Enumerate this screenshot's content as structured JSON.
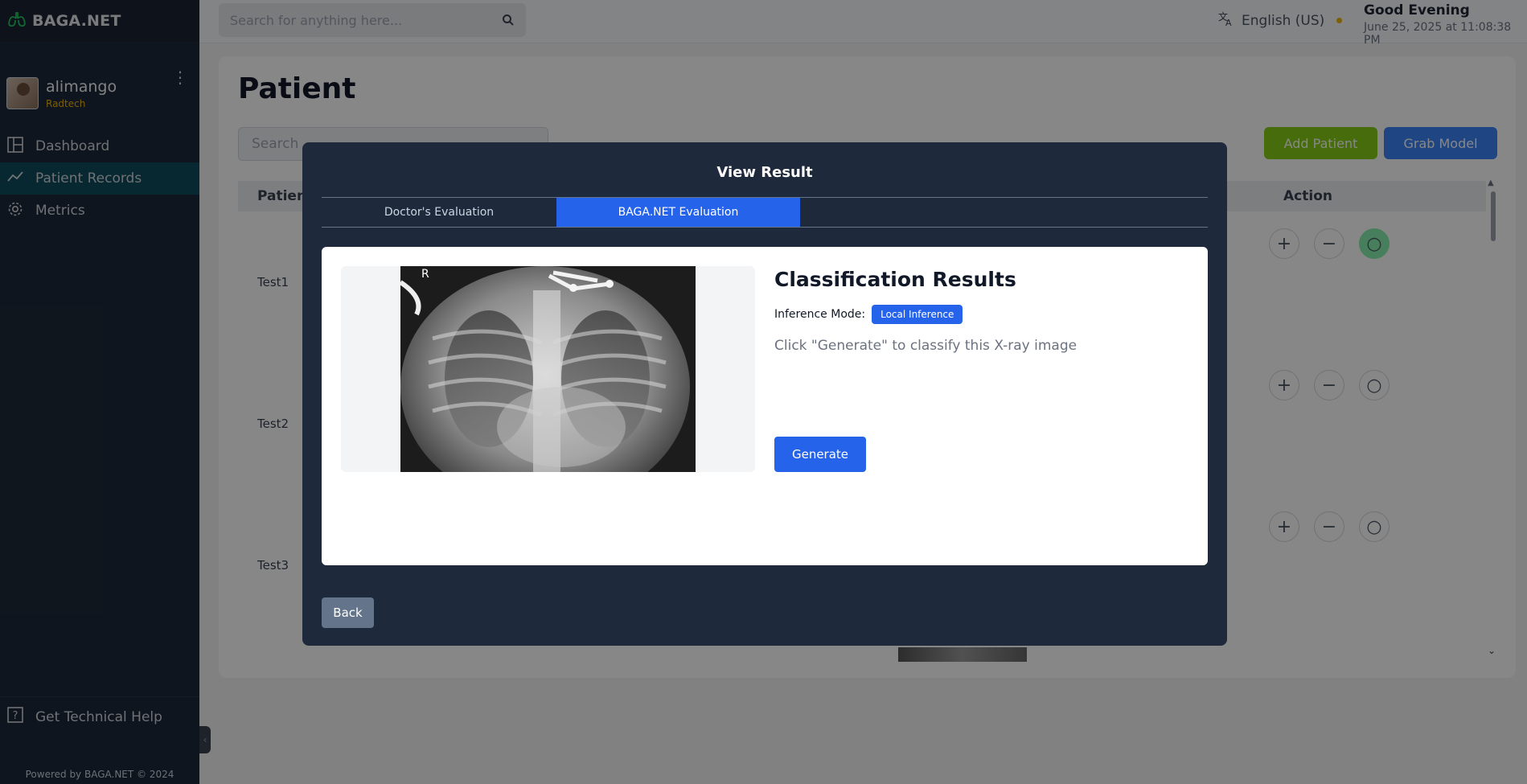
{
  "app": {
    "brand": "BAGA.NET"
  },
  "user": {
    "name": "alimango",
    "role": "Radtech"
  },
  "sidebar": {
    "items": [
      {
        "label": "Dashboard",
        "icon": "layout-icon"
      },
      {
        "label": "Patient Records",
        "icon": "trend-icon"
      },
      {
        "label": "Metrics",
        "icon": "gear-icon"
      }
    ],
    "help": "Get Technical Help",
    "footer": "Powered by BAGA.NET © 2024"
  },
  "topbar": {
    "search_placeholder": "Search for anything here...",
    "language": "English (US)",
    "greeting": "Good Evening",
    "datetime": "June 25, 2025 at 11:08:38 PM"
  },
  "page": {
    "title": "Patient",
    "search_placeholder": "Search",
    "add_label": "Add Patient",
    "grab_label": "Grab Model",
    "columns": {
      "patient": "Patient",
      "action": "Action"
    },
    "rows": [
      "Test1",
      "Test2",
      "Test3"
    ]
  },
  "modal": {
    "title": "View Result",
    "tabs": [
      "Doctor's Evaluation",
      "BAGA.NET Evaluation"
    ],
    "active_tab": "BAGA.NET Evaluation",
    "results_title": "Classification Results",
    "mode_label": "Inference Mode:",
    "mode_value": "Local Inference",
    "hint": "Click \"Generate\" to classify this X-ray image",
    "xray_marker": "R",
    "generate_label": "Generate",
    "back_label": "Back"
  },
  "colors": {
    "sidebar_bg": "#1e2939",
    "active_nav": "#0f4c5c",
    "accent_blue": "#2563eb",
    "add_green": "#84cc16",
    "role_yellow": "#eab308"
  }
}
